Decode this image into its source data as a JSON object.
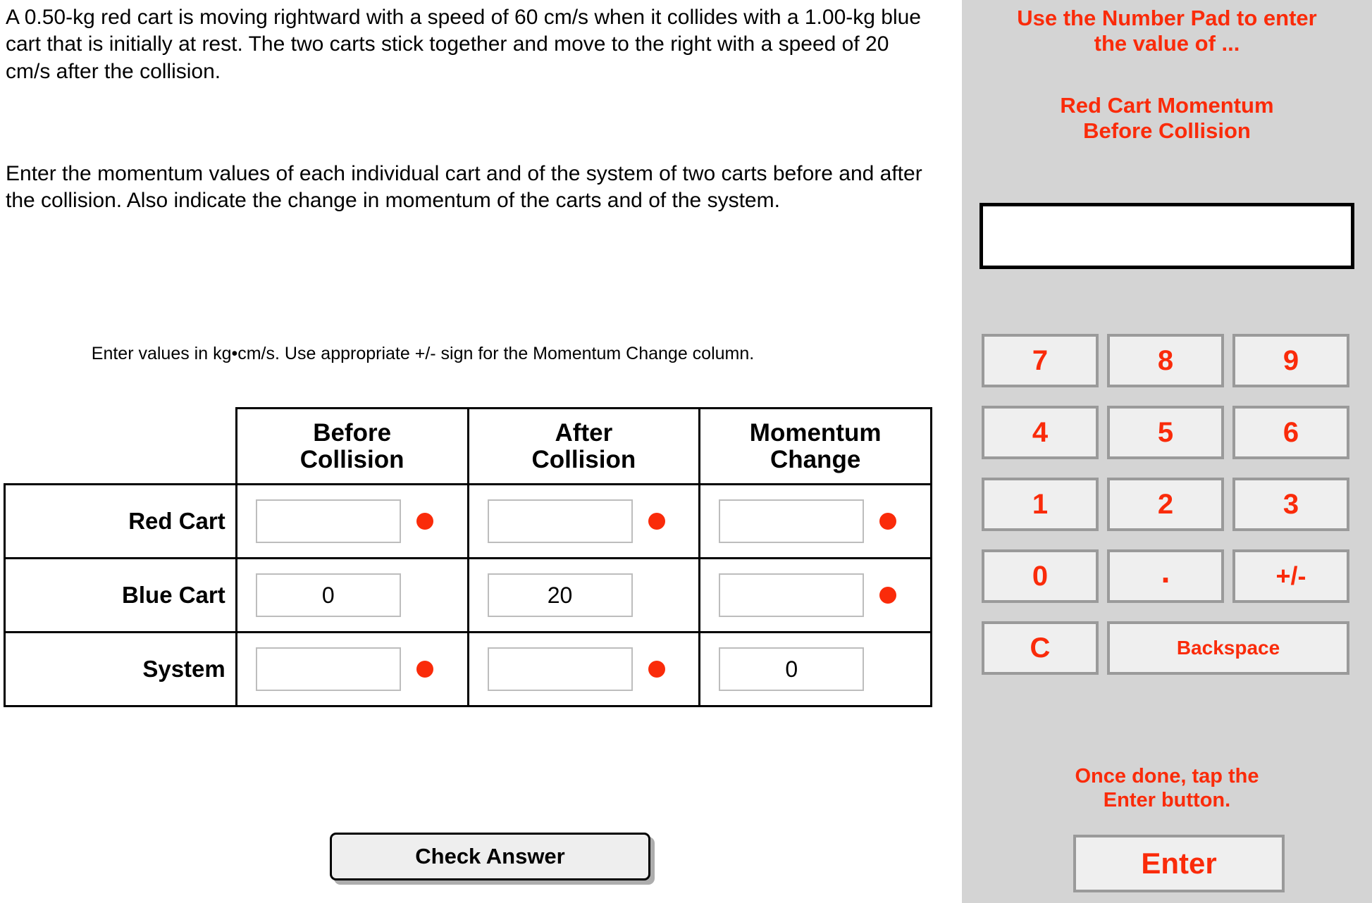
{
  "problem": {
    "statement": "A 0.50-kg red cart is moving rightward with a speed of 60 cm/s when it collides with a 1.00-kg blue cart that is initially at rest. The two carts stick together and move to the right with a speed of 20 cm/s after the collision.",
    "task": "Enter the momentum values of each individual cart and of the system of two carts before and after the collision. Also indicate the change in momentum of the carts and of the system.",
    "units_note": "Enter values in kg•cm/s. Use appropriate +/- sign for the Momentum Change column."
  },
  "table": {
    "headers": [
      {
        "line1": "Before",
        "line2": "Collision"
      },
      {
        "line1": "After",
        "line2": "Collision"
      },
      {
        "line1": "Momentum",
        "line2": "Change"
      }
    ],
    "rows": [
      {
        "label": "Red Cart",
        "cells": [
          {
            "value": "",
            "dot": true
          },
          {
            "value": "",
            "dot": true
          },
          {
            "value": "",
            "dot": true
          }
        ]
      },
      {
        "label": "Blue Cart",
        "cells": [
          {
            "value": "0",
            "dot": false
          },
          {
            "value": "20",
            "dot": false
          },
          {
            "value": "",
            "dot": true
          }
        ]
      },
      {
        "label": "System",
        "cells": [
          {
            "value": "",
            "dot": true
          },
          {
            "value": "",
            "dot": true
          },
          {
            "value": "0",
            "dot": false
          }
        ]
      }
    ]
  },
  "buttons": {
    "check_answer": "Check Answer"
  },
  "numberpad": {
    "instruction": "Use the Number Pad to enter\nthe value of ...",
    "target": "Red Cart Momentum\nBefore Collision",
    "display_value": "",
    "keys": [
      {
        "label": "7",
        "kind": "digit"
      },
      {
        "label": "8",
        "kind": "digit"
      },
      {
        "label": "9",
        "kind": "digit"
      },
      {
        "label": "4",
        "kind": "digit"
      },
      {
        "label": "5",
        "kind": "digit"
      },
      {
        "label": "6",
        "kind": "digit"
      },
      {
        "label": "1",
        "kind": "digit"
      },
      {
        "label": "2",
        "kind": "digit"
      },
      {
        "label": "3",
        "kind": "digit"
      },
      {
        "label": "0",
        "kind": "digit"
      },
      {
        "label": ".",
        "kind": "dot"
      },
      {
        "label": "+/-",
        "kind": "pm"
      },
      {
        "label": "C",
        "kind": "clear"
      },
      {
        "label": "Backspace",
        "kind": "wide"
      }
    ],
    "footer_note": "Once done, tap the\nEnter button.",
    "enter_label": "Enter"
  },
  "colors": {
    "accent_red": "#fa2b0a",
    "panel_gray": "#d4d4d4",
    "key_face": "#efefef",
    "key_border": "#9a9a9a"
  }
}
